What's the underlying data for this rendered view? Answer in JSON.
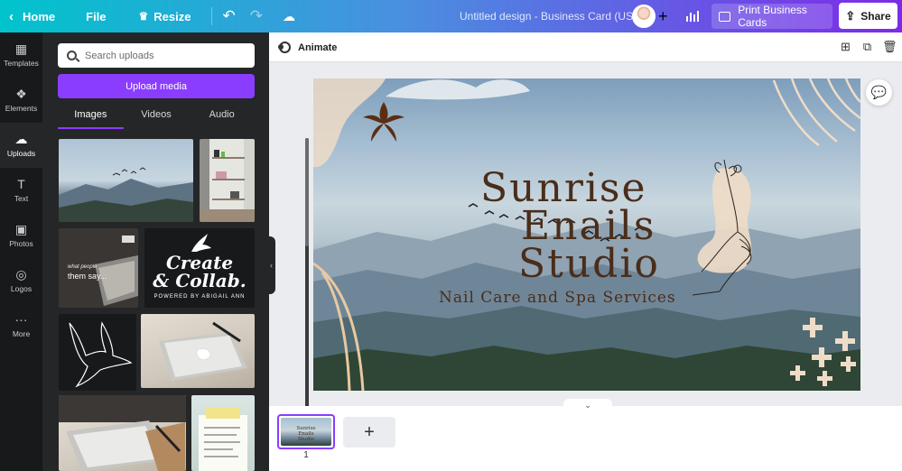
{
  "topbar": {
    "home": "Home",
    "file": "File",
    "resize": "Resize",
    "title": "Untitled design - Business Card (US)",
    "print": "Print Business Cards",
    "share": "Share"
  },
  "rail": [
    {
      "label": "Templates",
      "icon": "templates-icon"
    },
    {
      "label": "Elements",
      "icon": "elements-icon"
    },
    {
      "label": "Uploads",
      "icon": "uploads-icon",
      "active": true
    },
    {
      "label": "Text",
      "icon": "text-icon"
    },
    {
      "label": "Photos",
      "icon": "photos-icon"
    },
    {
      "label": "Logos",
      "icon": "logos-icon"
    },
    {
      "label": "More",
      "icon": "more-icon"
    }
  ],
  "uploads": {
    "search_placeholder": "Search uploads",
    "upload_button": "Upload media",
    "tabs": [
      "Images",
      "Videos",
      "Audio"
    ],
    "active_tab": "Images",
    "create_text": {
      "line1": "Create",
      "line2": "& Collab.",
      "line3": "POWERED BY ABIGAIL ANN"
    },
    "laptop_text": {
      "line1": "what people",
      "line2": "them say..."
    }
  },
  "canvas": {
    "animate": "Animate",
    "title_lines": [
      "Sunrise",
      "Enails",
      "Studio"
    ],
    "subtitle": "Nail Care and Spa Services",
    "accent_color": "#4a2d1a",
    "beige_color": "#efdcc7"
  },
  "pages": {
    "current": "1",
    "thumb_lines": [
      "Sunrise",
      "Enails",
      "Studio"
    ]
  }
}
